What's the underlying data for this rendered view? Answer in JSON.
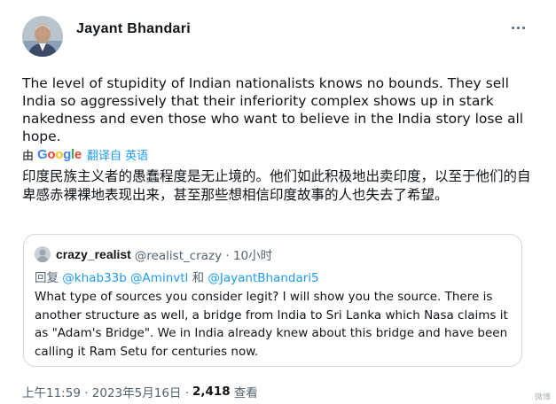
{
  "author": {
    "display_name": "Jayant Bhandari"
  },
  "tweet": {
    "text": "The level of stupidity of Indian nationalists knows no bounds. They sell India so aggressively that their inferiority complex shows up in stark nakedness and even those who want to believe in the India story lose all hope.",
    "translate_by": "由",
    "translate_provider": "Google",
    "translate_link": "翻译自 英语",
    "translated_text": "印度民族主义者的愚蠢程度是无止境的。他们如此积极地出卖印度，以至于他们的自卑感赤裸裸地表现出来，甚至那些想相信印度故事的人也失去了希望。"
  },
  "quote": {
    "name": "crazy_realist",
    "meta": "@realist_crazy · 10小时",
    "reply_prefix": "回复",
    "reply_mentions_1": "@khab33b @Aminvtl",
    "reply_and": "和",
    "reply_mentions_2": "@JayantBhandari5",
    "text": "What type of sources you consider legit? I will show you the source. There is another structure as well, a bridge from India to Sri Lanka which Nasa claims it as \"Adam's Bridge\". We in India already knew about this bridge and have been calling it Ram Setu for centuries now."
  },
  "footer": {
    "timestamp": "上午11:59 · 2023年5月16日 ·",
    "views_count": "2,418",
    "views_label": "查看"
  },
  "watermark": "微博",
  "icons": {
    "more": "more-horizontal-icon",
    "avatar": "avatar-image",
    "quote_avatar": "avatar-image"
  },
  "colors": {
    "link": "#1d9bf0",
    "secondary_text": "#536471",
    "border": "#cfd9de"
  }
}
